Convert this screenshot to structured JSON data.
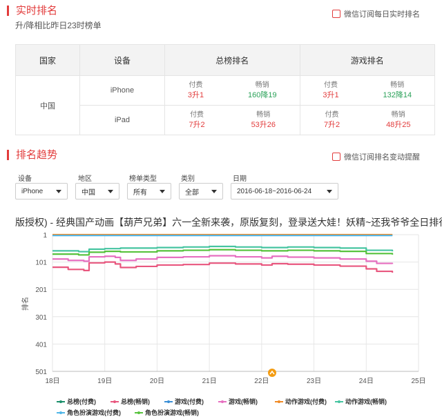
{
  "realtime": {
    "title": "实时排名",
    "subtitle": "升/降相比昨日23时榜单",
    "subscribe": "微信订阅每日实时排名",
    "table": {
      "headers": [
        "国家",
        "设备",
        "总榜排名",
        "游戏排名"
      ],
      "country": "中国",
      "rows": [
        {
          "device": "iPhone",
          "total": [
            {
              "label": "付费",
              "value": "3升1"
            },
            {
              "label": "畅销",
              "value": "160降19"
            }
          ],
          "game": [
            {
              "label": "付费",
              "value": "3升1"
            },
            {
              "label": "畅销",
              "value": "132降14"
            }
          ]
        },
        {
          "device": "iPad",
          "total": [
            {
              "label": "付费",
              "value": "7升2"
            },
            {
              "label": "畅销",
              "value": "53升26"
            }
          ],
          "game": [
            {
              "label": "付费",
              "value": "7升2"
            },
            {
              "label": "畅销",
              "value": "48升25"
            }
          ]
        }
      ]
    }
  },
  "trend": {
    "title": "排名趋势",
    "subscribe": "微信订阅排名变动提醒",
    "filters": [
      {
        "label": "设备",
        "value": "iPhone"
      },
      {
        "label": "地区",
        "value": "中国"
      },
      {
        "label": "榜单类型",
        "value": "所有"
      },
      {
        "label": "类别",
        "value": "全部"
      },
      {
        "label": "日期",
        "value": "2016-06-18~2016-06-24"
      }
    ],
    "marquee": "版授权) - 经典国产动画【葫芦兄弟】六一全新来袭，原版复刻，登录送大娃！妖精~还我爷爷全日排行",
    "ylabel": "排名"
  },
  "colors": {
    "accent": "#e23b3b",
    "up": "#e23b3b",
    "down": "#2aa158",
    "marker": "#f39c12"
  },
  "chart_data": {
    "type": "line",
    "ylabel": "排名",
    "y_inverted": true,
    "ylim": [
      1,
      501
    ],
    "yticks": [
      "1",
      "101",
      "201",
      "301",
      "401",
      "501"
    ],
    "x_ticks": [
      "18日",
      "19日",
      "20日",
      "21日",
      "22日",
      "23日",
      "24日",
      "25日"
    ],
    "x_range": [
      18,
      25
    ],
    "annotation_marker_x": 22.2,
    "grid": true,
    "legend_position": "bottom",
    "series": [
      {
        "name": "总榜(付费)",
        "color": "#1a8f6a",
        "x": [
          18,
          19,
          20,
          21,
          22,
          23,
          24,
          24.5
        ],
        "values": [
          3,
          3,
          3,
          3,
          3,
          3,
          3,
          3
        ]
      },
      {
        "name": "总榜(畅销)",
        "color": "#e8567e",
        "x": [
          18,
          18.3,
          18.6,
          18.7,
          19,
          19.2,
          19.3,
          19.6,
          20,
          20.5,
          21,
          21.5,
          22,
          22.2,
          22.5,
          23,
          23.5,
          24,
          24.2,
          24.5
        ],
        "values": [
          120,
          128,
          132,
          104,
          101,
          108,
          121,
          117,
          112,
          110,
          105,
          108,
          112,
          107,
          109,
          112,
          116,
          126,
          135,
          140
        ]
      },
      {
        "name": "游戏(付费)",
        "color": "#3a8fd6",
        "x": [
          18,
          19,
          20,
          21,
          22,
          23,
          24,
          24.5
        ],
        "values": [
          2,
          2,
          2,
          2,
          2,
          2,
          2,
          2
        ]
      },
      {
        "name": "游戏(畅销)",
        "color": "#e66fc0",
        "x": [
          18,
          18.3,
          18.6,
          18.7,
          19,
          19.2,
          19.3,
          19.6,
          20,
          20.5,
          21,
          21.5,
          22,
          22.2,
          22.5,
          23,
          23.5,
          24,
          24.2,
          24.5
        ],
        "values": [
          90,
          95,
          98,
          82,
          80,
          84,
          95,
          90,
          84,
          82,
          78,
          82,
          86,
          80,
          83,
          86,
          90,
          98,
          106,
          108
        ]
      },
      {
        "name": "动作游戏(付费)",
        "color": "#f08a24",
        "x": [
          18,
          19,
          20,
          21,
          22,
          23,
          24,
          24.5
        ],
        "values": [
          1,
          1,
          1,
          1,
          1,
          1,
          1,
          1
        ]
      },
      {
        "name": "动作游戏(畅销)",
        "color": "#45c4a0",
        "x": [
          18,
          18.5,
          18.7,
          19,
          19.3,
          20,
          20.5,
          21,
          21.5,
          22,
          22.5,
          23,
          23.5,
          24,
          24.5
        ],
        "values": [
          60,
          63,
          54,
          52,
          50,
          48,
          46,
          44,
          46,
          48,
          46,
          48,
          50,
          58,
          62
        ]
      },
      {
        "name": "角色扮演游戏(付费)",
        "color": "#4fb6e8",
        "x": [
          18,
          19,
          20,
          21,
          22,
          23,
          24,
          24.5
        ],
        "values": [
          4,
          4,
          4,
          4,
          4,
          4,
          4,
          4
        ]
      },
      {
        "name": "角色扮演游戏(畅销)",
        "color": "#56c23c",
        "x": [
          18,
          18.5,
          18.7,
          19,
          19.3,
          20,
          20.5,
          21,
          21.5,
          22,
          22.5,
          23,
          23.5,
          24,
          24.5
        ],
        "values": [
          72,
          75,
          65,
          62,
          64,
          60,
          58,
          56,
          58,
          60,
          58,
          60,
          62,
          70,
          74
        ]
      }
    ]
  }
}
